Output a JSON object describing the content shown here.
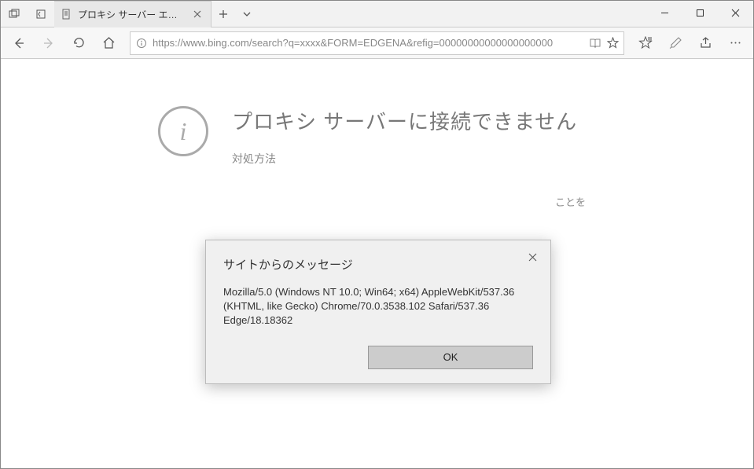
{
  "titlebar": {
    "tab_title": "プロキシ サーバー エラー"
  },
  "toolbar": {
    "url": "https://www.bing.com/search?q=xxxx&FORM=EDGENA&refig=00000000000000000000"
  },
  "page": {
    "heading": "プロキシ サーバーに接続できません",
    "subheading": "対処方法",
    "hint_fragment": "ことを"
  },
  "dialog": {
    "title": "サイトからのメッセージ",
    "message": "Mozilla/5.0 (Windows NT 10.0; Win64; x64) AppleWebKit/537.36 (KHTML, like Gecko) Chrome/70.0.3538.102 Safari/537.36 Edge/18.18362",
    "ok_label": "OK"
  }
}
